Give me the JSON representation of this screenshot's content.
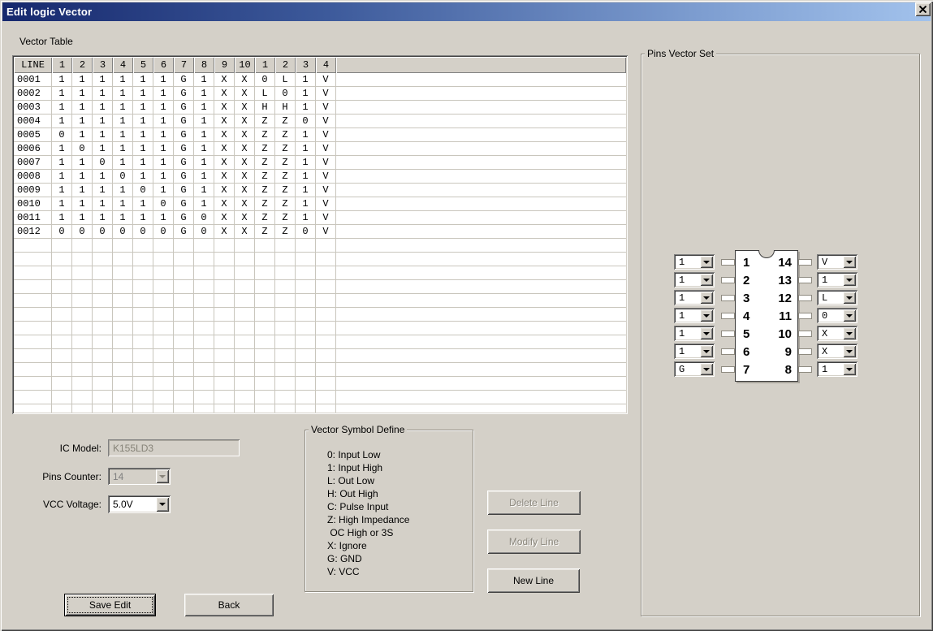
{
  "window": {
    "title": "Edit logic Vector"
  },
  "colors": {
    "dialog_bg": "#d4d0c8",
    "titlebar_gradient_left": "#16286d",
    "titlebar_gradient_right": "#a2c2ec",
    "table_grid": "#c9c6bd",
    "disabled_text": "#808080"
  },
  "vector_table": {
    "label": "Vector Table",
    "headers": [
      "LINE",
      "1",
      "2",
      "3",
      "4",
      "5",
      "6",
      "7",
      "8",
      "9",
      "10",
      "1",
      "2",
      "3",
      "4"
    ],
    "rows": [
      {
        "line": "0001",
        "values": [
          "1",
          "1",
          "1",
          "1",
          "1",
          "1",
          "G",
          "1",
          "X",
          "X",
          "0",
          "L",
          "1",
          "V"
        ]
      },
      {
        "line": "0002",
        "values": [
          "1",
          "1",
          "1",
          "1",
          "1",
          "1",
          "G",
          "1",
          "X",
          "X",
          "L",
          "0",
          "1",
          "V"
        ]
      },
      {
        "line": "0003",
        "values": [
          "1",
          "1",
          "1",
          "1",
          "1",
          "1",
          "G",
          "1",
          "X",
          "X",
          "H",
          "H",
          "1",
          "V"
        ]
      },
      {
        "line": "0004",
        "values": [
          "1",
          "1",
          "1",
          "1",
          "1",
          "1",
          "G",
          "1",
          "X",
          "X",
          "Z",
          "Z",
          "0",
          "V"
        ]
      },
      {
        "line": "0005",
        "values": [
          "0",
          "1",
          "1",
          "1",
          "1",
          "1",
          "G",
          "1",
          "X",
          "X",
          "Z",
          "Z",
          "1",
          "V"
        ]
      },
      {
        "line": "0006",
        "values": [
          "1",
          "0",
          "1",
          "1",
          "1",
          "1",
          "G",
          "1",
          "X",
          "X",
          "Z",
          "Z",
          "1",
          "V"
        ]
      },
      {
        "line": "0007",
        "values": [
          "1",
          "1",
          "0",
          "1",
          "1",
          "1",
          "G",
          "1",
          "X",
          "X",
          "Z",
          "Z",
          "1",
          "V"
        ]
      },
      {
        "line": "0008",
        "values": [
          "1",
          "1",
          "1",
          "0",
          "1",
          "1",
          "G",
          "1",
          "X",
          "X",
          "Z",
          "Z",
          "1",
          "V"
        ]
      },
      {
        "line": "0009",
        "values": [
          "1",
          "1",
          "1",
          "1",
          "0",
          "1",
          "G",
          "1",
          "X",
          "X",
          "Z",
          "Z",
          "1",
          "V"
        ]
      },
      {
        "line": "0010",
        "values": [
          "1",
          "1",
          "1",
          "1",
          "1",
          "0",
          "G",
          "1",
          "X",
          "X",
          "Z",
          "Z",
          "1",
          "V"
        ]
      },
      {
        "line": "0011",
        "values": [
          "1",
          "1",
          "1",
          "1",
          "1",
          "1",
          "G",
          "0",
          "X",
          "X",
          "Z",
          "Z",
          "1",
          "V"
        ]
      },
      {
        "line": "0012",
        "values": [
          "0",
          "0",
          "0",
          "0",
          "0",
          "0",
          "G",
          "0",
          "X",
          "X",
          "Z",
          "Z",
          "0",
          "V"
        ]
      }
    ],
    "empty_row_count": 13
  },
  "pins_vector_set": {
    "label": "Pins Vector Set",
    "left_pins": [
      {
        "pin": "1",
        "value": "1"
      },
      {
        "pin": "2",
        "value": "1"
      },
      {
        "pin": "3",
        "value": "1"
      },
      {
        "pin": "4",
        "value": "1"
      },
      {
        "pin": "5",
        "value": "1"
      },
      {
        "pin": "6",
        "value": "1"
      },
      {
        "pin": "7",
        "value": "G"
      }
    ],
    "right_pins": [
      {
        "pin": "14",
        "value": "V"
      },
      {
        "pin": "13",
        "value": "1"
      },
      {
        "pin": "12",
        "value": "L"
      },
      {
        "pin": "11",
        "value": "0"
      },
      {
        "pin": "10",
        "value": "X"
      },
      {
        "pin": "9",
        "value": "X"
      },
      {
        "pin": "8",
        "value": "1"
      }
    ]
  },
  "fields": {
    "ic_model": {
      "label": "IC Model:",
      "value": "K155LD3",
      "enabled": false
    },
    "pins_counter": {
      "label": "Pins Counter:",
      "value": "14",
      "enabled": false
    },
    "vcc_voltage": {
      "label": "VCC Voltage:",
      "value": "5.0V",
      "enabled": true
    }
  },
  "symbol_define": {
    "title": "Vector Symbol Define",
    "lines": [
      "0: Input Low",
      "1: Input High",
      "L: Out Low",
      "H: Out High",
      "C: Pulse Input",
      "Z: High Impedance",
      " OC High or 3S",
      "X: Ignore",
      "G: GND",
      "V: VCC"
    ]
  },
  "buttons": {
    "delete_line": {
      "label": "Delete Line",
      "enabled": false
    },
    "modify_line": {
      "label": "Modify Line",
      "enabled": false
    },
    "new_line": {
      "label": "New Line",
      "enabled": true
    },
    "save_edit": {
      "label": "Save Edit",
      "enabled": true
    },
    "back": {
      "label": "Back",
      "enabled": true
    }
  }
}
